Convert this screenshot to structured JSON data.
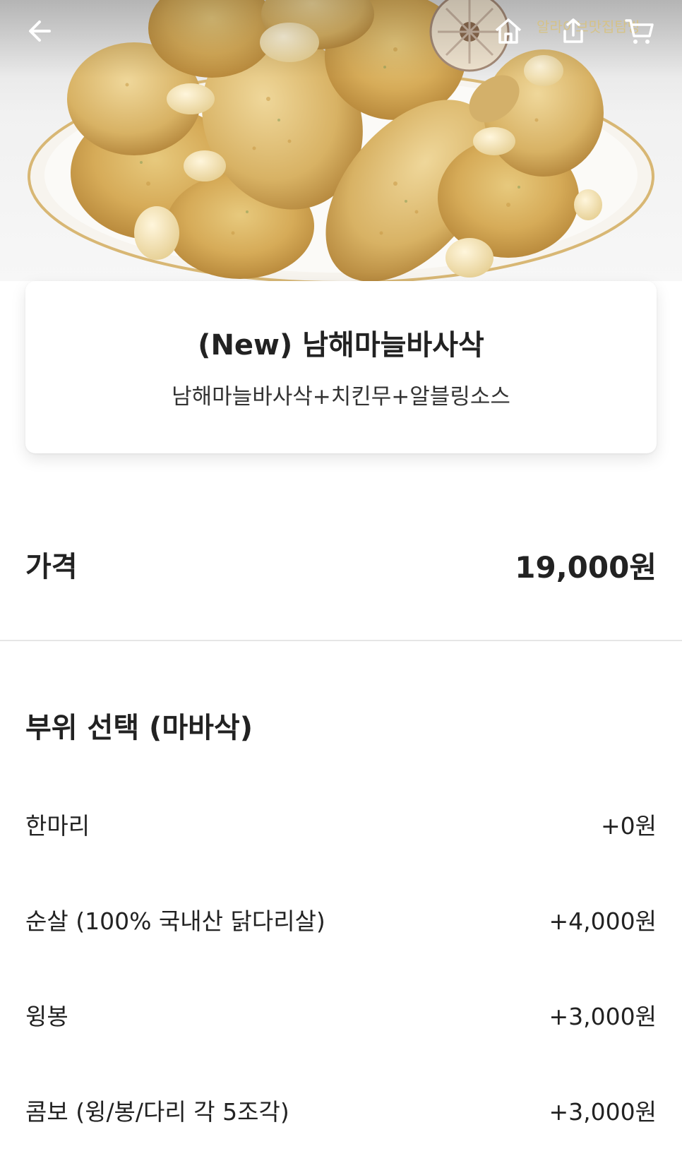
{
  "header": {
    "watermark": "알라이브맛집탐방"
  },
  "product": {
    "name": "(New) 남해마늘바사삭",
    "description": "남해마늘바사삭+치킨무+알블링소스"
  },
  "price": {
    "label": "가격",
    "value": "19,000원"
  },
  "option_group": {
    "title": "부위 선택 (마바삭)",
    "options": [
      {
        "name": "한마리",
        "price": "+0원"
      },
      {
        "name": "순살 (100% 국내산 닭다리살)",
        "price": "+4,000원"
      },
      {
        "name": "윙봉",
        "price": "+3,000원"
      },
      {
        "name": "콤보 (윙/봉/다리 각 5조각)",
        "price": "+3,000원"
      }
    ]
  }
}
